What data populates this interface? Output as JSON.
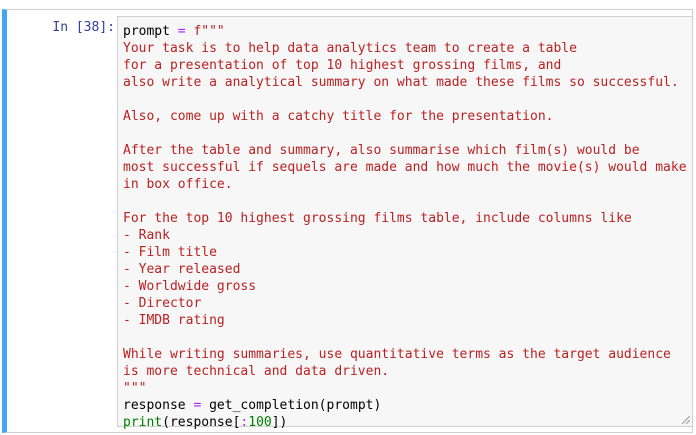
{
  "cell": {
    "prompt_label": "In [38]:",
    "code": {
      "line1_var": "prompt",
      "line1_op": "=",
      "line1_prefix": "f\"\"\"",
      "prompt_lines": [
        "Your task is to help data analytics team to create a table",
        "for a presentation of top 10 highest grossing films, and",
        "also write a analytical summary on what made these films so successful.",
        "",
        "Also, come up with a catchy title for the presentation.",
        "",
        "After the table and summary, also summarise which film(s) would be",
        "most successful if sequels are made and how much the movie(s) would make",
        "in box office.",
        "",
        "For the top 10 highest grossing films table, include columns like",
        "- Rank",
        "- Film title",
        "- Year released",
        "- Worldwide gross",
        "- Director",
        "- IMDB rating",
        "",
        "While writing summaries, use quantitative terms as the target audience",
        "is more technical and data driven."
      ],
      "closing_quotes": "\"\"\"",
      "line_response_var": "response",
      "line_response_op": "=",
      "line_response_call": "get_completion(prompt)",
      "print_kw": "print",
      "print_open": "(response[",
      "print_slice_op": ":",
      "print_num": "100",
      "print_close": "])"
    }
  },
  "colors": {
    "cell_border_accent": "#42a5f5",
    "prompt_color": "#303f9f",
    "string_color": "#ba2121",
    "keyword_color": "#008000",
    "operator_color": "#aa22ff"
  }
}
